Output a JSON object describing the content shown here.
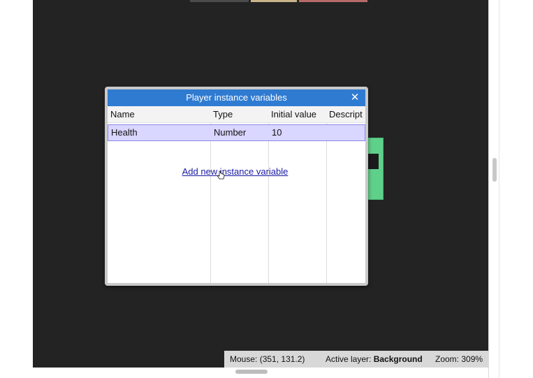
{
  "dialog": {
    "title": "Player instance variables",
    "close_glyph": "✕",
    "columns": [
      "Name",
      "Type",
      "Initial value",
      "Descript"
    ],
    "rows": [
      {
        "name": "Health",
        "type": "Number",
        "initial_value": "10",
        "description": ""
      }
    ],
    "add_link": "Add new instance variable"
  },
  "status_bar": {
    "mouse_label": "Mouse:",
    "mouse_value": "(351, 131.2)",
    "layer_label": "Active layer:",
    "layer_value": "Background",
    "zoom_label": "Zoom:",
    "zoom_value": "309%"
  },
  "colors": {
    "titlebar": "#2f7bd1",
    "canvas": "#232323",
    "selected_row": "#d9d6ff",
    "sprite": "#5fd08a"
  },
  "icons": {
    "close": "close-icon",
    "cursor": "hand-cursor-icon"
  }
}
